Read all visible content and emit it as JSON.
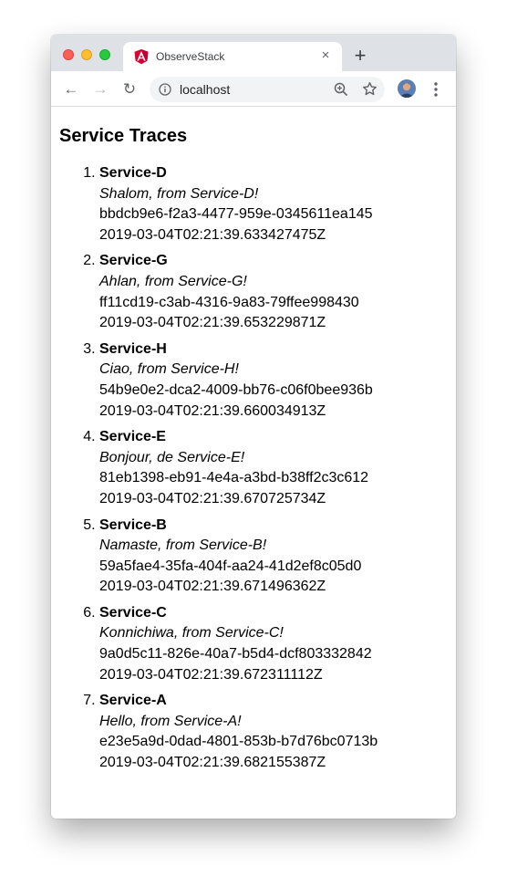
{
  "browser": {
    "tab_title": "ObserveStack",
    "tab_close": "×",
    "new_tab": "+",
    "url": "localhost",
    "back": "←",
    "forward": "→",
    "reload": "↻"
  },
  "page": {
    "heading": "Service Traces",
    "traces": [
      {
        "service": "Service-D",
        "greeting": "Shalom, from Service-D!",
        "trace_id": "bbdcb9e6-f2a3-4477-959e-0345611ea145",
        "timestamp": "2019-03-04T02:21:39.633427475Z"
      },
      {
        "service": "Service-G",
        "greeting": "Ahlan, from Service-G!",
        "trace_id": "ff11cd19-c3ab-4316-9a83-79ffee998430",
        "timestamp": "2019-03-04T02:21:39.653229871Z"
      },
      {
        "service": "Service-H",
        "greeting": "Ciao, from Service-H!",
        "trace_id": "54b9e0e2-dca2-4009-bb76-c06f0bee936b",
        "timestamp": "2019-03-04T02:21:39.660034913Z"
      },
      {
        "service": "Service-E",
        "greeting": "Bonjour, de Service-E!",
        "trace_id": "81eb1398-eb91-4e4a-a3bd-b38ff2c3c612",
        "timestamp": "2019-03-04T02:21:39.670725734Z"
      },
      {
        "service": "Service-B",
        "greeting": "Namaste, from Service-B!",
        "trace_id": "59a5fae4-35fa-404f-aa24-41d2ef8c05d0",
        "timestamp": "2019-03-04T02:21:39.671496362Z"
      },
      {
        "service": "Service-C",
        "greeting": "Konnichiwa, from Service-C!",
        "trace_id": "9a0d5c11-826e-40a7-b5d4-dcf803332842",
        "timestamp": "2019-03-04T02:21:39.672311112Z"
      },
      {
        "service": "Service-A",
        "greeting": "Hello, from Service-A!",
        "trace_id": "e23e5a9d-0dad-4801-853b-b7d76bc0713b",
        "timestamp": "2019-03-04T02:21:39.682155387Z"
      }
    ]
  },
  "icons": {
    "tab_favicon": "angular-logo-icon",
    "info": "info-icon",
    "zoom": "zoom-icon",
    "bookmark": "star-icon",
    "profile": "avatar",
    "menu": "kebab-menu-icon"
  },
  "colors": {
    "titlebar": "#dee1e6",
    "angular_red": "#dd0031",
    "close_dot": "#fe5f57",
    "minimize_dot": "#febc2e",
    "maximize_dot": "#28c840",
    "omnibox": "#f1f3f4"
  }
}
